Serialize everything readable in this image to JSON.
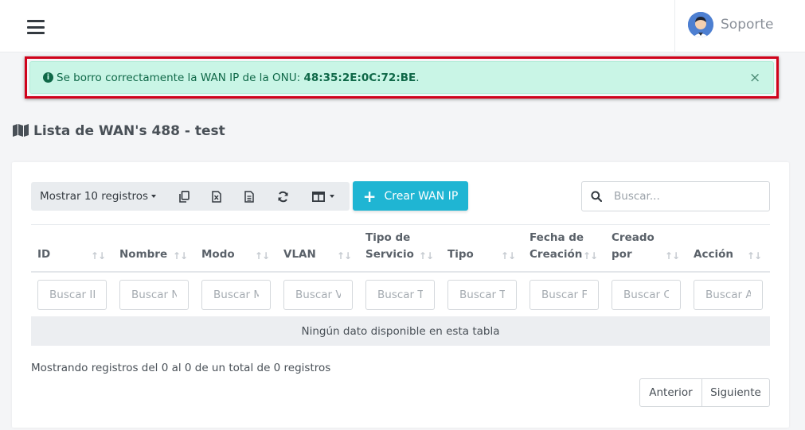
{
  "header": {
    "user_name": "Soporte"
  },
  "alert": {
    "message": "Se borro correctamente la WAN IP de la ONU: ",
    "onu": "48:35:2E:0C:72:BE",
    "suffix": ".",
    "close": "×",
    "color": "#c9f5e6"
  },
  "page": {
    "title": "Lista de WAN's 488 - test"
  },
  "toolbar": {
    "show_entries": "Mostrar 10 registros",
    "create_button": "Crear WAN IP",
    "create_color": "#1fb5d3",
    "icons": [
      "copy-icon",
      "excel-icon",
      "csv-icon",
      "refresh-icon",
      "columns-icon"
    ]
  },
  "search": {
    "placeholder": "Buscar..."
  },
  "table": {
    "columns": [
      {
        "line1": "",
        "line2": "ID",
        "filter": "Buscar ID"
      },
      {
        "line1": "",
        "line2": "Nombre",
        "filter": "Buscar Nombre"
      },
      {
        "line1": "",
        "line2": "Modo",
        "filter": "Buscar Modo"
      },
      {
        "line1": "",
        "line2": "VLAN",
        "filter": "Buscar VLAN"
      },
      {
        "line1": "Tipo de",
        "line2": "Servicio",
        "filter": "Buscar Tipo de Servicio"
      },
      {
        "line1": "",
        "line2": "Tipo",
        "filter": "Buscar Tipo"
      },
      {
        "line1": "Fecha de",
        "line2": "Creación",
        "filter": "Buscar Fecha de Creación"
      },
      {
        "line1": "Creado",
        "line2": "por",
        "filter": "Buscar Creado por"
      },
      {
        "line1": "",
        "line2": "Acción",
        "filter": "Buscar Acción"
      }
    ],
    "sort_glyph": "↑↓",
    "empty_message": "Ningún dato disponible en esta tabla"
  },
  "footer": {
    "info": "Mostrando registros del 0 al 0 de un total de 0 registros",
    "prev": "Anterior",
    "next": "Siguiente"
  }
}
